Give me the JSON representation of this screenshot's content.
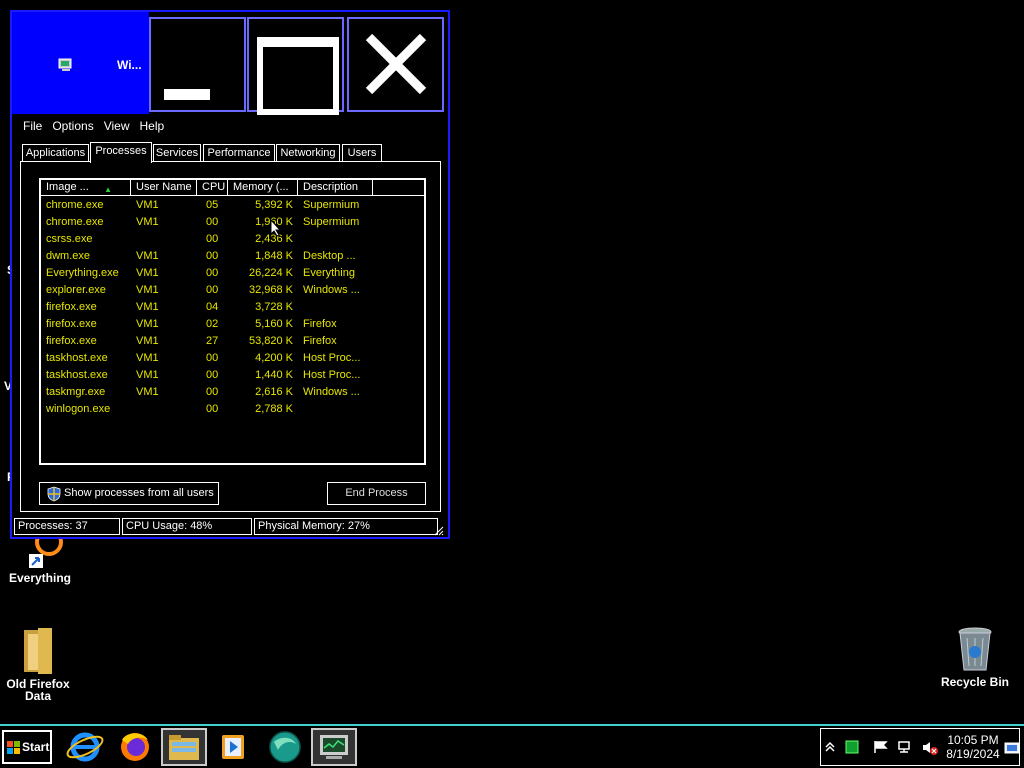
{
  "window": {
    "title": "Wi...",
    "menu": [
      "File",
      "Options",
      "View",
      "Help"
    ],
    "tabs": [
      "Applications",
      "Processes",
      "Services",
      "Performance",
      "Networking",
      "Users"
    ],
    "active_tab": "Processes",
    "columns": [
      "Image ...",
      "User Name",
      "CPU",
      "Memory (...",
      "Description"
    ],
    "processes": [
      {
        "image": "chrome.exe",
        "user": "VM1",
        "cpu": "05",
        "memory": "5,392 K",
        "description": "Supermium"
      },
      {
        "image": "chrome.exe",
        "user": "VM1",
        "cpu": "00",
        "memory": "1,960 K",
        "description": "Supermium"
      },
      {
        "image": "csrss.exe",
        "user": "",
        "cpu": "00",
        "memory": "2,436 K",
        "description": ""
      },
      {
        "image": "dwm.exe",
        "user": "VM1",
        "cpu": "00",
        "memory": "1,848 K",
        "description": "Desktop ..."
      },
      {
        "image": "Everything.exe",
        "user": "VM1",
        "cpu": "00",
        "memory": "26,224 K",
        "description": "Everything"
      },
      {
        "image": "explorer.exe",
        "user": "VM1",
        "cpu": "00",
        "memory": "32,968 K",
        "description": "Windows ..."
      },
      {
        "image": "firefox.exe",
        "user": "VM1",
        "cpu": "04",
        "memory": "3,728 K",
        "description": ""
      },
      {
        "image": "firefox.exe",
        "user": "VM1",
        "cpu": "02",
        "memory": "5,160 K",
        "description": "Firefox"
      },
      {
        "image": "firefox.exe",
        "user": "VM1",
        "cpu": "27",
        "memory": "53,820 K",
        "description": "Firefox"
      },
      {
        "image": "taskhost.exe",
        "user": "VM1",
        "cpu": "00",
        "memory": "4,200 K",
        "description": "Host Proc..."
      },
      {
        "image": "taskhost.exe",
        "user": "VM1",
        "cpu": "00",
        "memory": "1,440 K",
        "description": "Host Proc..."
      },
      {
        "image": "taskmgr.exe",
        "user": "VM1",
        "cpu": "00",
        "memory": "2,616 K",
        "description": "Windows ..."
      },
      {
        "image": "winlogon.exe",
        "user": "",
        "cpu": "00",
        "memory": "2,788 K",
        "description": ""
      }
    ],
    "show_all_label": "Show processes from all users",
    "end_process_label": "End Process",
    "status": {
      "processes": "Processes: 37",
      "cpu": "CPU Usage: 48%",
      "memory": "Physical Memory: 27%"
    }
  },
  "desktop": {
    "icons": [
      {
        "label": "Everything",
        "icon": "everything-shortcut-icon"
      },
      {
        "label": "Old Firefox Data",
        "icon": "folder-icon"
      },
      {
        "label": "Recycle Bin",
        "icon": "recycle-bin-icon"
      }
    ],
    "edge_chars": [
      "S",
      "V",
      "F"
    ]
  },
  "taskbar": {
    "start_label": "Start",
    "pinned": [
      "internet-explorer-icon",
      "firefox-icon",
      "file-explorer-icon",
      "media-player-icon",
      "browser-globe-icon",
      "task-manager-icon"
    ],
    "clock_time": "10:05 PM",
    "clock_date": "8/19/2024"
  },
  "colors": {
    "title_blue": "#0000ff",
    "row_text": "#e6e600",
    "taskbar_border": "#3fd0d0"
  }
}
